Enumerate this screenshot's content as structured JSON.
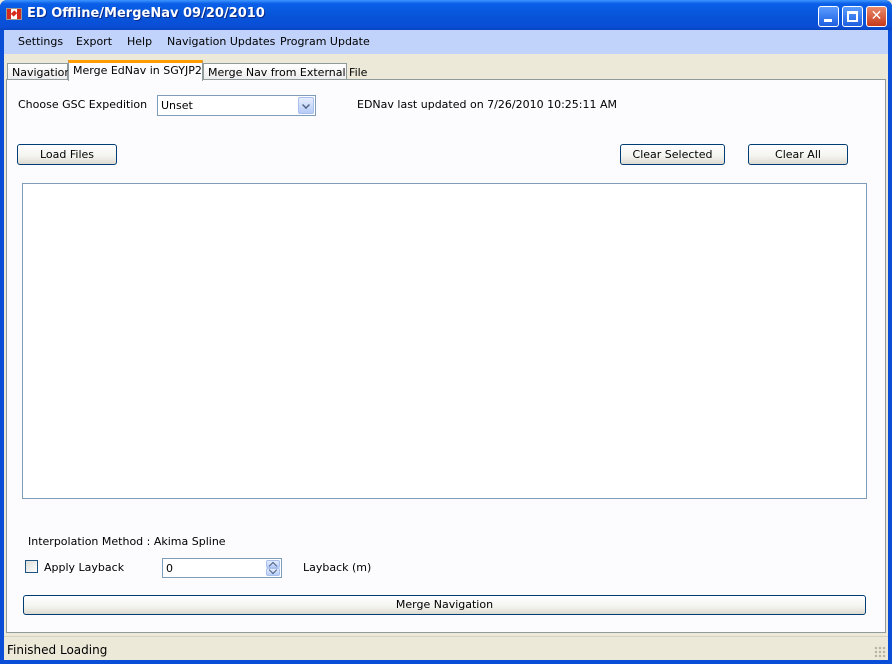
{
  "window": {
    "title": "ED Offline/MergeNav 09/20/2010",
    "icon": "canada-flag-icon",
    "controls": {
      "minimize": "_",
      "maximize": "□",
      "close": "✕"
    }
  },
  "menu": [
    "Settings",
    "Export",
    "Help",
    "Navigation Updates",
    "Program Update"
  ],
  "tabs": [
    {
      "label": "Navigation",
      "active": false
    },
    {
      "label": "Merge EdNav in SGYJP2",
      "active": true
    },
    {
      "label": "Merge Nav from External File",
      "active": false
    }
  ],
  "merge": {
    "expedition_label": "Choose GSC  Expedition",
    "expedition_value": "Unset",
    "ednav_updated": "EDNav last updated on 7/26/2010 10:25:11 AM",
    "load_files": "Load Files",
    "clear_selected": "Clear Selected",
    "clear_all": "Clear All",
    "files": [],
    "interpolation": "Interpolation Method : Akima Spline",
    "apply_layback": "Apply Layback",
    "apply_layback_checked": false,
    "layback_value": "0",
    "layback_label": "Layback (m)",
    "merge_button": "Merge Navigation"
  },
  "status": {
    "text": "Finished Loading"
  },
  "colors": {
    "titlebar": "#0a4ed8",
    "menubar": "#c1d3fb",
    "active_tab_accent": "#ff9c00",
    "face": "#ece9d8"
  }
}
